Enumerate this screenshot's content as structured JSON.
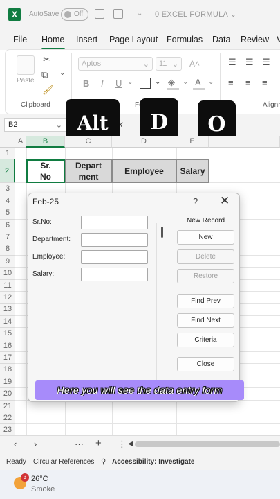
{
  "titlebar": {
    "autosave": "AutoSave",
    "toggle_state": "Off",
    "filename": "0 EXCEL FORMULA"
  },
  "menu": [
    "File",
    "Home",
    "Insert",
    "Page Layout",
    "Formulas",
    "Data",
    "Review"
  ],
  "ribbon": {
    "paste": "Paste",
    "clipboard": "Clipboard",
    "font_name": "Aptos",
    "font_size": "11",
    "align_label": "Alignr",
    "font_group": "Fo"
  },
  "formula_bar": {
    "name_box": "B2",
    "fx": "fx"
  },
  "keys": [
    "Alt",
    "D",
    "O"
  ],
  "columns": [
    "A",
    "B",
    "C",
    "D",
    "E"
  ],
  "rows": [
    "1",
    "2",
    "3",
    "4",
    "5",
    "6",
    "7",
    "8",
    "9",
    "10",
    "11",
    "12",
    "13",
    "14",
    "15",
    "16",
    "17",
    "18",
    "19",
    "20",
    "21",
    "22",
    "23"
  ],
  "headers": {
    "sr_no": "Sr.\nNo",
    "department": "Depart\nment",
    "employee": "Employee",
    "salary": "Salary"
  },
  "dialog": {
    "title": "Feb-25",
    "help": "?",
    "close": "✕",
    "record_status": "New Record",
    "fields": [
      "Sr.No:",
      "Department:",
      "Employee:",
      "Salary:"
    ],
    "buttons": [
      "New",
      "Delete",
      "Restore",
      "Find Prev",
      "Find Next",
      "Criteria",
      "Close"
    ]
  },
  "caption": "Here you will see the data entry form",
  "status": {
    "ready": "Ready",
    "circular": "Circular References",
    "accessibility": "Accessibility: Investigate"
  },
  "taskbar": {
    "badge": "3",
    "temperature": "26°C",
    "weather": "Smoke"
  },
  "colors": {
    "excel_green": "#107c41",
    "caption_bg": "#a78bfa",
    "header_fill": "#d9d9d9"
  }
}
